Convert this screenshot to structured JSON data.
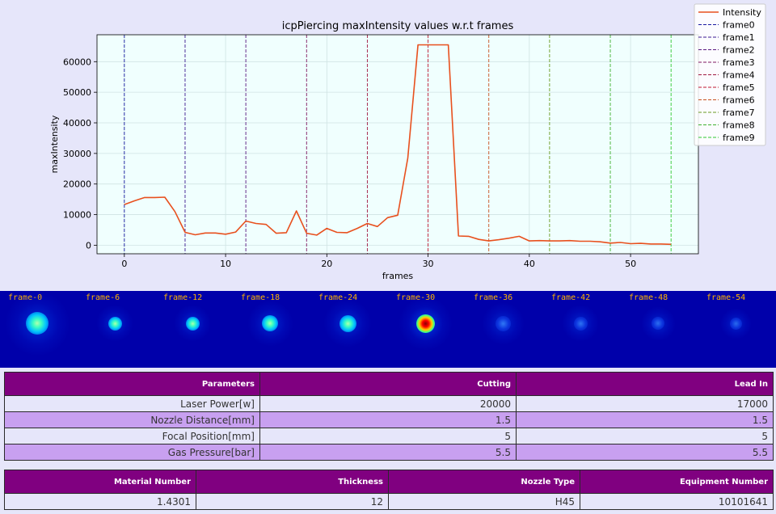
{
  "chart_data": {
    "type": "line",
    "title": "icpPiercing maxIntensity values w.r.t frames",
    "xlabel": "frames",
    "ylabel": "maxIntensity",
    "xlim": [
      -2.7,
      56.7
    ],
    "ylim": [
      -2800,
      68800
    ],
    "xticks": [
      0,
      10,
      20,
      30,
      40,
      50
    ],
    "yticks": [
      0,
      10000,
      20000,
      30000,
      40000,
      50000,
      60000
    ],
    "grid": true,
    "legend_position": "top-right",
    "background": "#f0fffe",
    "series": [
      {
        "name": "Intensity",
        "color": "#e8501e",
        "x": [
          0,
          1,
          2,
          3,
          4,
          5,
          6,
          7,
          8,
          9,
          10,
          11,
          12,
          13,
          14,
          15,
          16,
          17,
          18,
          19,
          20,
          21,
          22,
          23,
          24,
          25,
          26,
          27,
          28,
          29,
          30,
          31,
          32,
          33,
          34,
          35,
          36,
          37,
          38,
          39,
          40,
          41,
          42,
          43,
          44,
          45,
          46,
          47,
          48,
          49,
          50,
          51,
          52,
          53,
          54
        ],
        "y": [
          13300,
          14500,
          15600,
          15600,
          15700,
          11000,
          4200,
          3400,
          4000,
          4000,
          3600,
          4300,
          7900,
          7100,
          6800,
          3900,
          4100,
          11200,
          3900,
          3300,
          5500,
          4200,
          4100,
          5500,
          7100,
          6100,
          9000,
          9800,
          28500,
          65500,
          65500,
          65500,
          65500,
          3000,
          2900,
          1900,
          1400,
          1800,
          2300,
          2900,
          1400,
          1500,
          1400,
          1400,
          1500,
          1300,
          1300,
          1100,
          700,
          900,
          500,
          600,
          400,
          400,
          300
        ]
      }
    ],
    "vlines": [
      {
        "name": "frame0",
        "x": 0,
        "color": "#1818a0"
      },
      {
        "name": "frame1",
        "x": 6,
        "color": "#3a1890"
      },
      {
        "name": "frame2",
        "x": 12,
        "color": "#5a1880"
      },
      {
        "name": "frame3",
        "x": 18,
        "color": "#801860"
      },
      {
        "name": "frame4",
        "x": 24,
        "color": "#a01840"
      },
      {
        "name": "frame5",
        "x": 30,
        "color": "#c01830"
      },
      {
        "name": "frame6",
        "x": 36,
        "color": "#c85020"
      },
      {
        "name": "frame7",
        "x": 42,
        "color": "#6a9a20"
      },
      {
        "name": "frame8",
        "x": 48,
        "color": "#40b030"
      },
      {
        "name": "frame9",
        "x": 54,
        "color": "#30c830"
      }
    ]
  },
  "frames": [
    {
      "label": "frame-0",
      "intensity": 0.45,
      "size": 0.9
    },
    {
      "label": "frame-6",
      "intensity": 0.3,
      "size": 0.4
    },
    {
      "label": "frame-12",
      "intensity": 0.35,
      "size": 0.4
    },
    {
      "label": "frame-18",
      "intensity": 0.3,
      "size": 0.55
    },
    {
      "label": "frame-24",
      "intensity": 0.4,
      "size": 0.6
    },
    {
      "label": "frame-30",
      "intensity": 1.0,
      "size": 0.7
    },
    {
      "label": "frame-36",
      "intensity": 0.2,
      "size": 0.5
    },
    {
      "label": "frame-42",
      "intensity": 0.15,
      "size": 0.4
    },
    {
      "label": "frame-48",
      "intensity": 0.12,
      "size": 0.35
    },
    {
      "label": "frame-54",
      "intensity": 0.08,
      "size": 0.3
    }
  ],
  "params_table": {
    "headers": [
      "Parameters",
      "Cutting",
      "Lead In"
    ],
    "rows": [
      [
        "Laser Power[w]",
        "20000",
        "17000"
      ],
      [
        "Nozzle Distance[mm]",
        "1.5",
        "1.5"
      ],
      [
        "Focal Position[mm]",
        "5",
        "5"
      ],
      [
        "Gas Pressure[bar]",
        "5.5",
        "5.5"
      ]
    ]
  },
  "material_table": {
    "headers": [
      "Material Number",
      "Thickness",
      "Nozzle Type",
      "Equipment Number"
    ],
    "rows": [
      [
        "1.4301",
        "12",
        "H45",
        "10101641"
      ]
    ]
  }
}
